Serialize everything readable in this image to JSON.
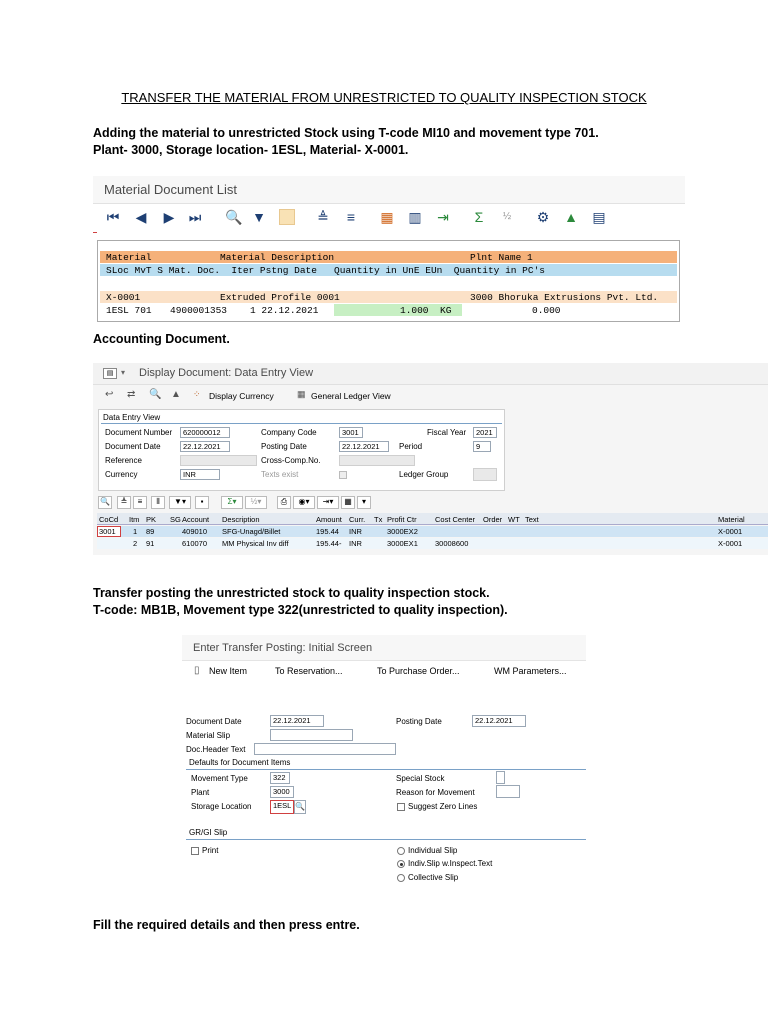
{
  "title": "TRANSFER THE MATERIAL FROM UNRESTRICTED TO QUALITY INSPECTION STOCK",
  "intro_line1": "Adding the material to unrestricted Stock using T-code MI10 and movement type 701.",
  "intro_line2": "Plant- 3000, Storage location- 1ESL, Material- X-0001.",
  "mdl": {
    "title": "Material Document List",
    "header_row1": [
      "Material",
      "Material Description",
      "Plnt Name 1"
    ],
    "header_row2": "SLoc MvT S Mat. Doc.  Iter Pstng Date   Quantity in UnE EUn  Quantity in PC's",
    "data_row1": [
      "X-0001",
      "Extruded Profile 0001",
      "3000 Bhoruka Extrusions Pvt. Ltd."
    ],
    "data_row2": {
      "sloc_mvt": "1ESL 701",
      "mat_doc": "4900001353",
      "item_date": "1 22.12.2021",
      "qty": "1.000",
      "uom": "KG",
      "qty_pc": "0.000"
    }
  },
  "accounting_label": "Accounting Document.",
  "dd": {
    "title": "Display Document: Data Entry View",
    "display_currency": "Display Currency",
    "general_ledger_view": "General Ledger View",
    "section": "Data Entry View",
    "document_number_label": "Document Number",
    "document_number": "620000012",
    "company_code_label": "Company Code",
    "company_code": "3001",
    "fiscal_year_label": "Fiscal Year",
    "fiscal_year": "2021",
    "document_date_label": "Document Date",
    "document_date": "22.12.2021",
    "posting_date_label": "Posting Date",
    "posting_date": "22.12.2021",
    "period_label": "Period",
    "period": "9",
    "reference_label": "Reference",
    "cross_comp_label": "Cross-Comp.No.",
    "currency_label": "Currency",
    "currency": "INR",
    "texts_exist_label": "Texts exist",
    "ledger_group_label": "Ledger Group",
    "columns": [
      "CoCd",
      "Itm",
      "PK",
      "SG",
      "Account",
      "Description",
      "Amount",
      "Curr.",
      "Tx",
      "Profit Ctr",
      "Cost Center",
      "Order",
      "WT",
      "Text",
      "Material"
    ],
    "rows": [
      {
        "cocd": "3001",
        "itm": "1",
        "pk": "89",
        "account": "409010",
        "desc": "SFG-Unagd/Billet",
        "amount": "195.44",
        "curr": "INR",
        "profit": "3000EX2",
        "cost": "",
        "material": "X-0001"
      },
      {
        "cocd": "",
        "itm": "2",
        "pk": "91",
        "account": "610070",
        "desc": "MM Physical Inv diff",
        "amount": "195.44-",
        "curr": "INR",
        "profit": "3000EX1",
        "cost": "30008600",
        "material": "X-0001"
      }
    ]
  },
  "transfer_line1": "Transfer posting the unrestricted stock to quality inspection stock.",
  "transfer_line2": "T-code: MB1B, Movement type 322(unrestricted to quality inspection).",
  "tp": {
    "title": "Enter Transfer Posting: Initial Screen",
    "new_item": "New Item",
    "to_reservation": "To Reservation...",
    "to_purchase_order": "To Purchase Order...",
    "wm_parameters": "WM Parameters...",
    "document_date_label": "Document Date",
    "document_date": "22.12.2021",
    "posting_date_label": "Posting Date",
    "posting_date": "22.12.2021",
    "material_slip_label": "Material Slip",
    "doc_header_label": "Doc.Header Text",
    "defaults_section": "Defaults for Document Items",
    "movement_type_label": "Movement Type",
    "movement_type": "322",
    "special_stock_label": "Special Stock",
    "plant_label": "Plant",
    "plant": "3000",
    "reason_label": "Reason for Movement",
    "storage_location_label": "Storage Location",
    "storage_location": "1ESL",
    "suggest_zero_label": "Suggest Zero Lines",
    "grgi_section": "GR/GI Slip",
    "print_label": "Print",
    "individual_slip": "Individual Slip",
    "indiv_slip_inspect": "Indiv.Slip w.Inspect.Text",
    "collective_slip": "Collective Slip"
  },
  "footer_text": "Fill the required details and then press entre."
}
